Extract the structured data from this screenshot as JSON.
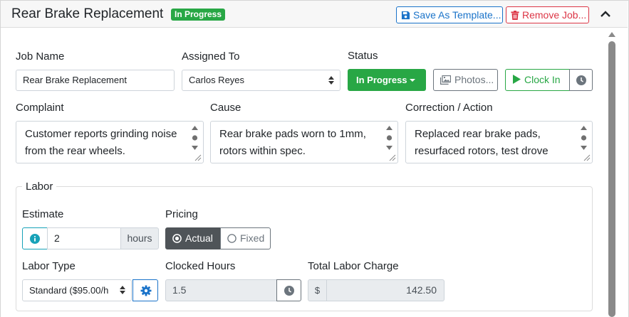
{
  "header": {
    "title": "Rear Brake Replacement",
    "status_badge": "In Progress",
    "save_template_label": "Save As Template...",
    "remove_job_label": "Remove Job..."
  },
  "job": {
    "name_label": "Job Name",
    "name_value": "Rear Brake Replacement",
    "assigned_label": "Assigned To",
    "assigned_value": "Carlos Reyes",
    "status_label": "Status",
    "status_value": "In Progress",
    "photos_label": "Photos...",
    "clock_in_label": "Clock In"
  },
  "notes": {
    "complaint_label": "Complaint",
    "complaint_text": "Customer reports grinding noise from the rear wheels.",
    "cause_label": "Cause",
    "cause_text": "Rear brake pads worn to 1mm, rotors within spec.",
    "correction_label": "Correction / Action",
    "correction_text": "Replaced rear brake pads, resurfaced rotors, test drove"
  },
  "labor": {
    "legend": "Labor",
    "estimate_label": "Estimate",
    "estimate_value": "2",
    "estimate_unit": "hours",
    "pricing_label": "Pricing",
    "pricing_options": [
      "Actual",
      "Fixed"
    ],
    "pricing_selected": "Actual",
    "labor_type_label": "Labor Type",
    "labor_type_value": "Standard ($95.00/h",
    "clocked_hours_label": "Clocked Hours",
    "clocked_hours_value": "1.5",
    "total_label": "Total Labor Charge",
    "currency_symbol": "$",
    "total_value": "142.50"
  },
  "colors": {
    "success": "#28a745",
    "primary": "#1a73c9",
    "danger": "#dc3545",
    "info": "#17a2b8",
    "secondary": "#6c757d"
  }
}
